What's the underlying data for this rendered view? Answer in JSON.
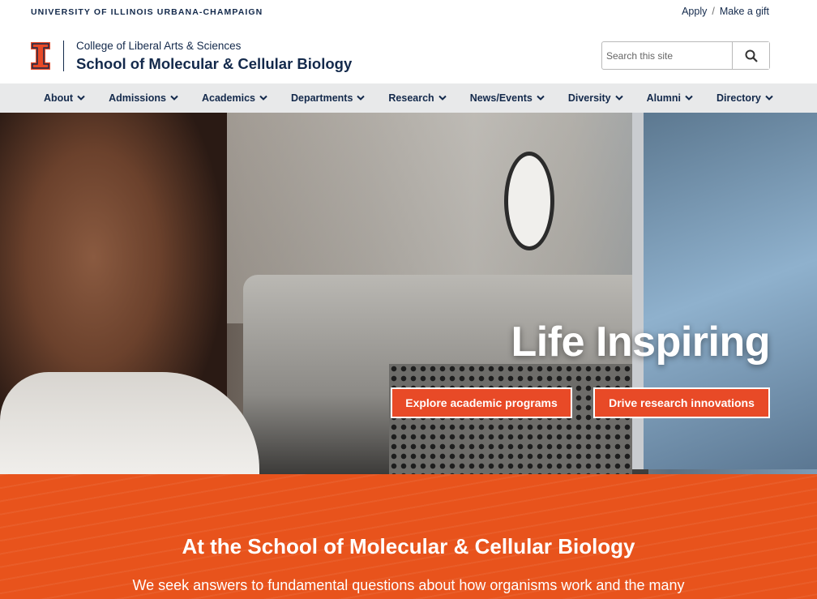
{
  "topbar": {
    "university": "UNIVERSITY OF ILLINOIS URBANA-CHAMPAIGN",
    "links": [
      "Apply",
      "Make a gift"
    ],
    "separator": "/"
  },
  "header": {
    "college": "College of Liberal Arts & Sciences",
    "school": "School of Molecular & Cellular Biology",
    "search_placeholder": "Search this site"
  },
  "nav": {
    "items": [
      "About",
      "Admissions",
      "Academics",
      "Departments",
      "Research",
      "News/Events",
      "Diversity",
      "Alumni",
      "Directory"
    ]
  },
  "hero": {
    "title": "Life Inspiring",
    "buttons": [
      "Explore academic programs",
      "Drive research innovations"
    ]
  },
  "band": {
    "heading": "At the School of Molecular & Cellular Biology",
    "text": "We seek answers to fundamental questions about how organisms work and the many"
  },
  "colors": {
    "navy": "#13294b",
    "orange": "#e84a27",
    "nav_bg": "#e8e9ea"
  }
}
